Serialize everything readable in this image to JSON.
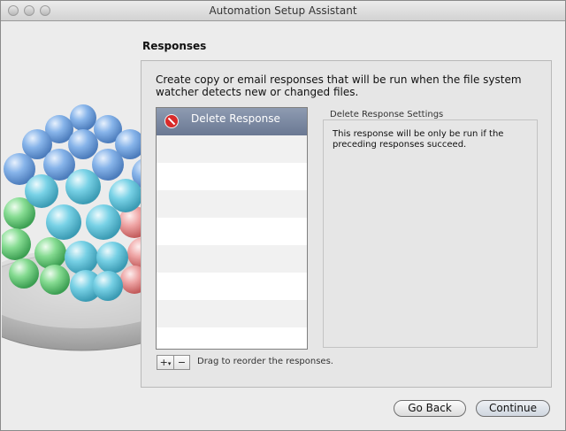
{
  "window": {
    "title": "Automation Setup Assistant"
  },
  "section": {
    "title": "Responses"
  },
  "description": "Create copy or email responses that will be run when the file system watcher detects new or changed files.",
  "list": {
    "items": [
      {
        "label": "Delete Response",
        "icon": "delete-icon",
        "selected": true
      }
    ],
    "empty_rows": 8
  },
  "settings": {
    "label": "Delete Response Settings",
    "text": "This response will be only be run if the preceding responses succeed."
  },
  "controls": {
    "add": "+",
    "add_menu_indicator": "▾",
    "remove": "−",
    "hint": "Drag to reorder the responses."
  },
  "buttons": {
    "go_back": "Go Back",
    "continue": "Continue"
  },
  "colors": {
    "selection": "#6a7893",
    "delete_icon": "#d82a2a"
  }
}
